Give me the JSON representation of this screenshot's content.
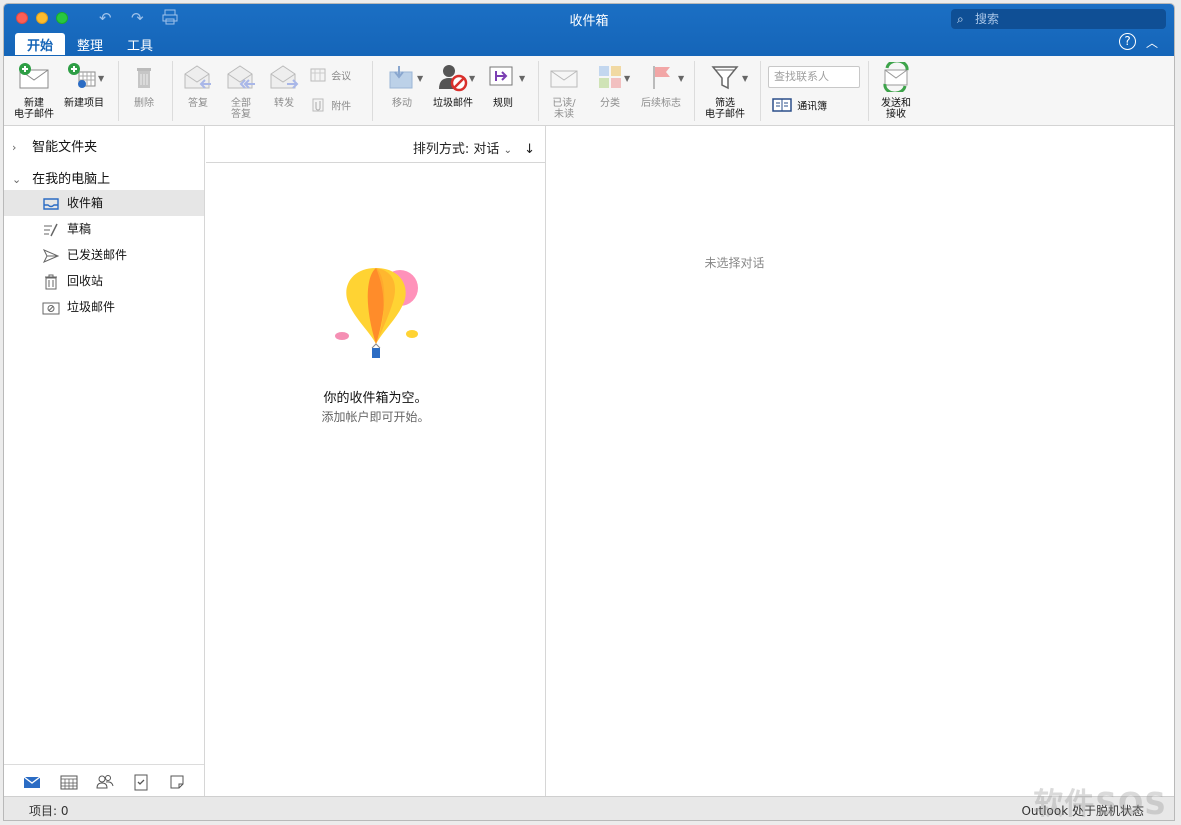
{
  "window": {
    "title": "收件箱",
    "search_placeholder": "搜索",
    "tabs": [
      "开始",
      "整理",
      "工具"
    ],
    "help_icon": "?"
  },
  "ribbon": {
    "new_email": "新建\n电子邮件",
    "new_item": "新建项目",
    "delete": "删除",
    "reply": "答复",
    "reply_all": "全部\n答复",
    "forward": "转发",
    "meeting": "会议",
    "attachment": "附件",
    "move": "移动",
    "junk": "垃圾邮件",
    "rules": "规则",
    "read_unread": "已读/\n未读",
    "categorize": "分类",
    "follow_up": "后续标志",
    "filter_email": "筛选\n电子邮件",
    "find_contact_placeholder": "查找联系人",
    "address_book": "通讯簿",
    "send_receive": "发送和\n接收"
  },
  "folders": {
    "smart_folders": "智能文件夹",
    "on_my_computer": "在我的电脑上",
    "items": [
      {
        "label": "收件箱",
        "icon": "inbox-icon",
        "selected": true
      },
      {
        "label": "草稿",
        "icon": "drafts-icon",
        "selected": false
      },
      {
        "label": "已发送邮件",
        "icon": "sent-icon",
        "selected": false
      },
      {
        "label": "回收站",
        "icon": "trash-icon",
        "selected": false
      },
      {
        "label": "垃圾邮件",
        "icon": "junk-icon",
        "selected": false
      }
    ]
  },
  "list": {
    "sort_label": "排列方式: 对话",
    "empty_title": "你的收件箱为空。",
    "empty_subtitle": "添加帐户即可开始。"
  },
  "reading": {
    "no_selection": "未选择对话"
  },
  "status": {
    "items_count": "项目: 0",
    "offline": "Outlook 处于脱机状态"
  },
  "watermark": "软件SOS",
  "colors": {
    "titlebar": "#1565b8",
    "accent": "#1565b8"
  }
}
